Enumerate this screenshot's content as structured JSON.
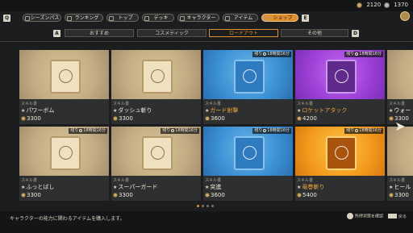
{
  "currency": {
    "gold": "2120",
    "silver": "1370"
  },
  "nav": {
    "key_left": "Q",
    "key_right": "E",
    "tabs": [
      "シーズンパス",
      "ランキング",
      "トップ",
      "デッキ",
      "キャラクター",
      "アイテム",
      "ショップ"
    ],
    "active_index": 6
  },
  "subnav": {
    "key_left": "A",
    "key_right": "D",
    "tabs": [
      "おすすめ",
      "コスメティック",
      "ロードアウト",
      "その他"
    ],
    "active_index": 2
  },
  "items": [
    {
      "category": "スキル書",
      "name": "パワーボム",
      "price": "3300",
      "rarity": "tan",
      "timer": null
    },
    {
      "category": "スキル書",
      "name": "ダッシュ斬り",
      "price": "3300",
      "rarity": "tan",
      "timer": null
    },
    {
      "category": "スキル書",
      "name": "ガード射撃",
      "price": "3600",
      "rarity": "blue",
      "timer": "18時間16分",
      "timer_label": "残り"
    },
    {
      "category": "スキル書",
      "name": "ロケットアタック",
      "price": "4200",
      "rarity": "purple",
      "timer": "18時間16分",
      "timer_label": "残り"
    },
    {
      "category": "スキル書",
      "name": "ウォー",
      "price": "3300",
      "rarity": "tan",
      "timer": null
    },
    {
      "category": "スキル書",
      "name": "ふっとばし",
      "price": "3300",
      "rarity": "tan",
      "timer": "18時間16分",
      "timer_label": "残り"
    },
    {
      "category": "スキル書",
      "name": "スーパーガード",
      "price": "3300",
      "rarity": "tan",
      "timer": "18時間16分",
      "timer_label": "残り"
    },
    {
      "category": "スキル書",
      "name": "突進",
      "price": "3600",
      "rarity": "blue",
      "timer": "18時間16分",
      "timer_label": "残り"
    },
    {
      "category": "スキル書",
      "name": "竜巻斬り",
      "price": "5400",
      "rarity": "orange",
      "timer": "18時間16分",
      "timer_label": "残り"
    },
    {
      "category": "スキル書",
      "name": "ヒール",
      "price": "3300",
      "rarity": "tan",
      "timer": null
    }
  ],
  "bottom": {
    "hint": "キャラクターの能力に関わるアイテムを購入します。",
    "confirm_label": "所持状態を確認",
    "back_label": "戻る"
  },
  "colors": {
    "accent": "#e1902f"
  }
}
